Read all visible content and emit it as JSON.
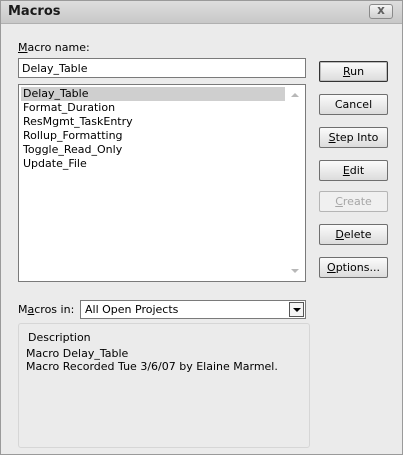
{
  "window": {
    "title": "Macros",
    "close_glyph": "x",
    "close_icon": "close-icon"
  },
  "macro_name": {
    "label": "Macro name:",
    "value": "Delay_Table"
  },
  "macro_list": {
    "items": [
      {
        "label": "Delay_Table",
        "selected": true
      },
      {
        "label": "Format_Duration",
        "selected": false
      },
      {
        "label": "ResMgmt_TaskEntry",
        "selected": false
      },
      {
        "label": "Rollup_Formatting",
        "selected": false
      },
      {
        "label": "Toggle_Read_Only",
        "selected": false
      },
      {
        "label": "Update_File",
        "selected": false
      }
    ]
  },
  "buttons": {
    "run": "Run",
    "cancel": "Cancel",
    "step_into": "Step Into",
    "edit": "Edit",
    "create": "Create",
    "delete": "Delete",
    "options": "Options..."
  },
  "macros_in": {
    "label": "Macros in:",
    "value": "All Open Projects"
  },
  "description": {
    "label": "Description",
    "line1": "Macro Delay_Table",
    "line2": "Macro Recorded Tue 3/6/07 by Elaine Marmel."
  },
  "colors": {
    "dialog_bg": "#ebebeb",
    "selection": "#cfcfcf",
    "disabled_text": "#a6a6a6"
  }
}
